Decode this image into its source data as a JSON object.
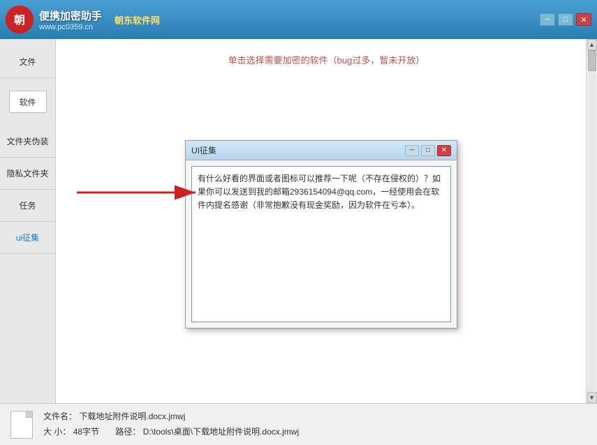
{
  "titlebar": {
    "logo_text": "朝",
    "main_title": "朝东软件网",
    "subtitle": "www.pc0359.cn",
    "app_name": "便携加密助手",
    "controls": {
      "minimize": "─",
      "maximize": "□",
      "close": "✕"
    }
  },
  "sidebar": {
    "items": [
      {
        "label": "文件",
        "id": "files"
      },
      {
        "label": "软件",
        "id": "software",
        "is_button": true
      },
      {
        "label": "文件夹伪装",
        "id": "folder-disguise"
      },
      {
        "label": "隐私文件夹",
        "id": "private-folder"
      },
      {
        "label": "任务",
        "id": "tasks"
      },
      {
        "label": "ui征集",
        "id": "ui-collect",
        "active": true
      }
    ]
  },
  "content": {
    "notice": "单击选择需要加密的软件（bug过多，暂未开放）"
  },
  "dialog": {
    "title": "UI征集",
    "controls": {
      "minimize": "─",
      "maximize": "□",
      "close": "✕"
    },
    "text": "有什么好看的界面或者图标可以推荐一下呢（不存在侵权的）？如果你可以发送到我的邮箱2936154094@qq.com，一经使用会在软件内提名感谢（非常抱歉没有现金奖励，因为软件在亏本）。"
  },
  "statusbar": {
    "filename_label": "文件名：",
    "filename": "下载地址附件说明.docx.jmwj",
    "size_label": "大  小：",
    "size": "48字节",
    "path_label": "路径：",
    "path": "D:\\tools\\桌面\\下载地址附件说明.docx.jmwj"
  }
}
